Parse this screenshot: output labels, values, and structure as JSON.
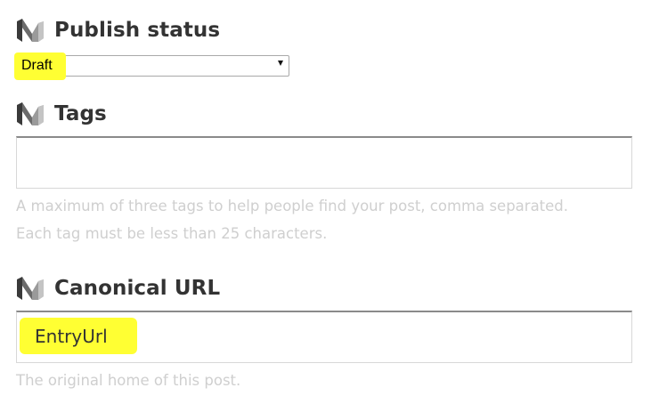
{
  "publish_status": {
    "title": "Publish status",
    "selected_value": "Draft"
  },
  "tags": {
    "title": "Tags",
    "value": "",
    "hint_line1": "A maximum of three tags to help people find your post, comma separated.",
    "hint_line2": "Each tag must be less than 25 characters."
  },
  "canonical_url": {
    "title": "Canonical URL",
    "value": "EntryUrl",
    "hint": "The original home of this post."
  },
  "icons": {
    "section_logo": "medium-logo-icon",
    "select_arrow": "dropdown-arrow-icon"
  },
  "colors": {
    "highlight": "#ffff33",
    "hint_text": "#cfcfcf",
    "title_text": "#333333"
  }
}
